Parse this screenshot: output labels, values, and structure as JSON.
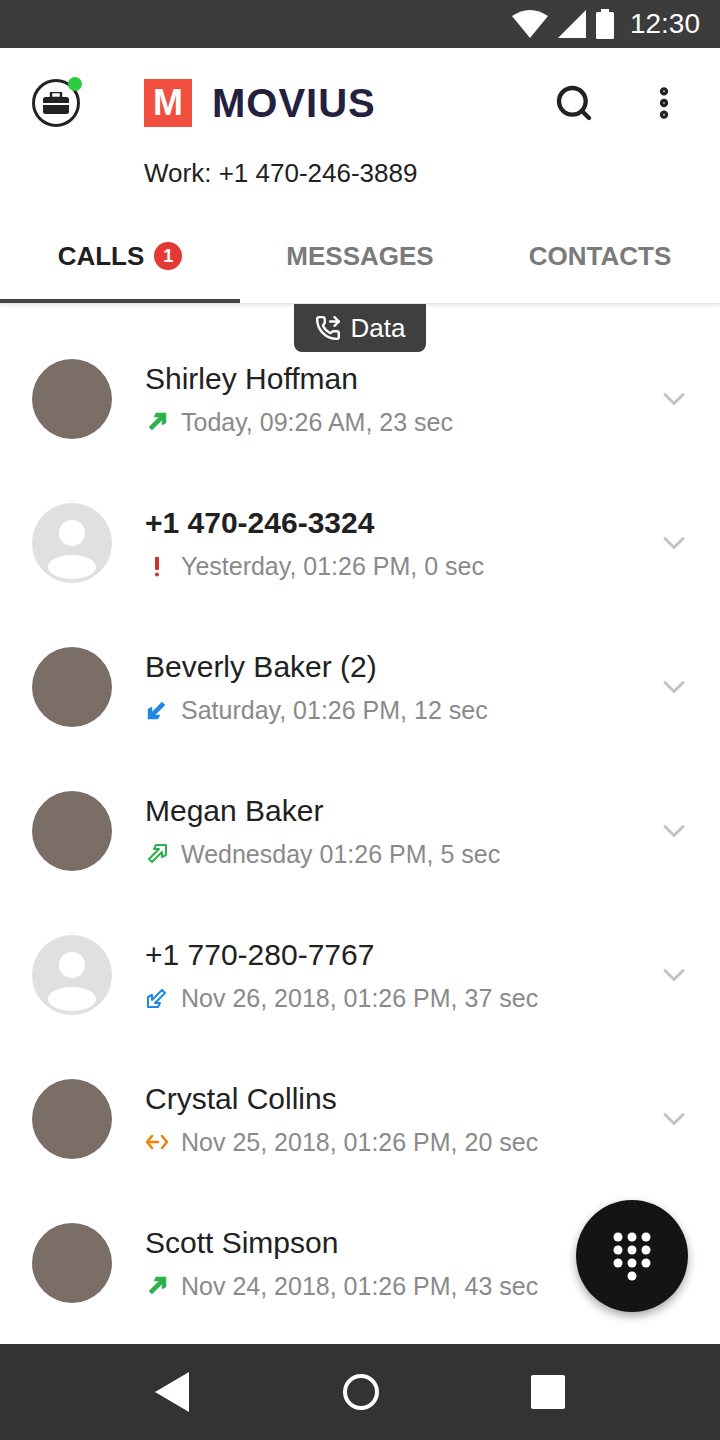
{
  "status_bar": {
    "time": "12:30"
  },
  "header": {
    "logo_mark": "M",
    "logo": "MOVIUS",
    "work_number": "Work: +1 470-246-3889",
    "online": true
  },
  "tabs": [
    {
      "label": "CALLS",
      "badge": "1",
      "selected": true
    },
    {
      "label": "MESSAGES",
      "badge": "",
      "selected": false
    },
    {
      "label": "CONTACTS",
      "badge": "",
      "selected": false
    }
  ],
  "call_mode": {
    "label": "Data"
  },
  "calls": [
    {
      "name": "Shirley Hoffman",
      "detail": "Today, 09:26 AM, 23 sec",
      "kind": "outgoing",
      "has_photo": true,
      "unread": false
    },
    {
      "name": "+1 470-246-3324",
      "detail": "Yesterday, 01:26 PM, 0 sec",
      "kind": "missed",
      "has_photo": false,
      "unread": true
    },
    {
      "name": "Beverly Baker (2)",
      "detail": "Saturday, 01:26 PM, 12 sec",
      "kind": "incoming",
      "has_photo": true,
      "unread": false
    },
    {
      "name": "Megan Baker",
      "detail": "Wednesday 01:26 PM, 5 sec",
      "kind": "outgoing-data",
      "has_photo": true,
      "unread": false
    },
    {
      "name": "+1 770-280-7767",
      "detail": "Nov 26, 2018, 01:26 PM, 37 sec",
      "kind": "incoming-data",
      "has_photo": false,
      "unread": false
    },
    {
      "name": "Crystal Collins",
      "detail": "Nov 25, 2018, 01:26 PM, 20 sec",
      "kind": "forwarded",
      "has_photo": true,
      "unread": false
    },
    {
      "name": "Scott Simpson",
      "detail": "Nov 24, 2018, 01:26 PM, 43 sec",
      "kind": "outgoing",
      "has_photo": true,
      "unread": false
    }
  ]
}
